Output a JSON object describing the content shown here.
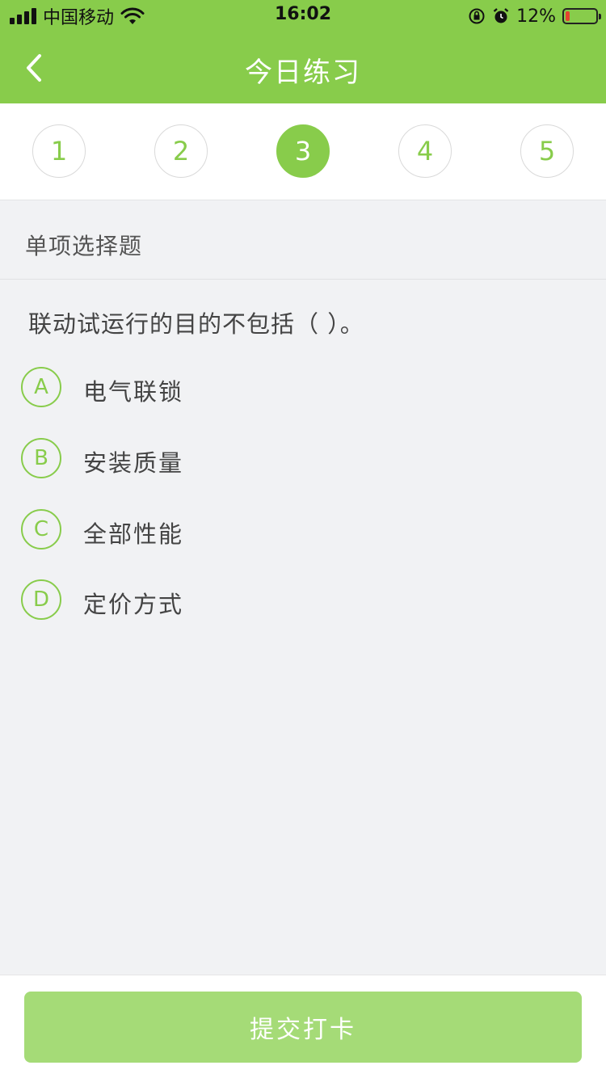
{
  "status_bar": {
    "carrier": "中国移动",
    "time": "16:02",
    "battery": "12%",
    "battery_level": 0.12,
    "icons": [
      "signal-icon",
      "wifi-icon",
      "orientation-lock-icon",
      "alarm-icon",
      "battery-icon"
    ]
  },
  "nav": {
    "title": "今日练习",
    "back_icon": "chevron-left-icon"
  },
  "tabs": [
    {
      "label": "1",
      "active": false
    },
    {
      "label": "2",
      "active": false
    },
    {
      "label": "3",
      "active": true
    },
    {
      "label": "4",
      "active": false
    },
    {
      "label": "5",
      "active": false
    }
  ],
  "question": {
    "type": "单项选择题",
    "text": "联动试运行的目的不包括（ ）。",
    "options": [
      {
        "letter": "A",
        "text": "电气联锁"
      },
      {
        "letter": "B",
        "text": "安装质量"
      },
      {
        "letter": "C",
        "text": "全部性能"
      },
      {
        "letter": "D",
        "text": "定价方式"
      }
    ]
  },
  "footer": {
    "submit_label": "提交打卡"
  },
  "colors": {
    "brand_green": "#88cc4b",
    "submit_green": "#a5db77",
    "background": "#f1f2f4",
    "battery_low": "#e5432f"
  }
}
